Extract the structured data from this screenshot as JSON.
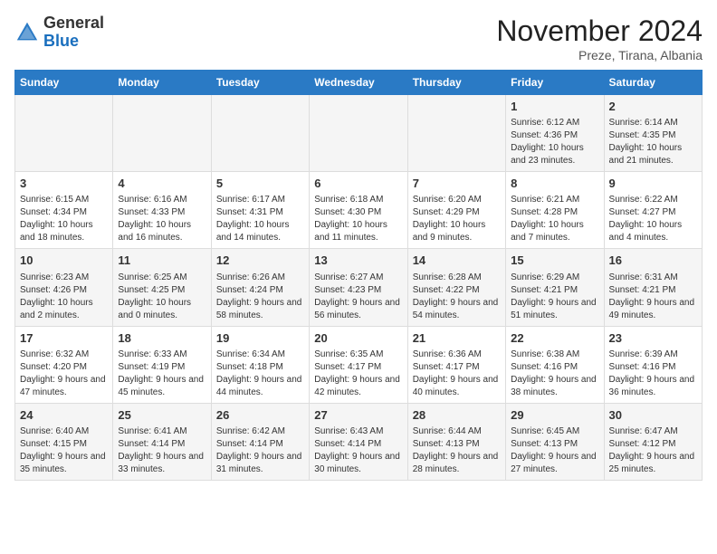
{
  "header": {
    "logo_general": "General",
    "logo_blue": "Blue",
    "month_title": "November 2024",
    "subtitle": "Preze, Tirana, Albania"
  },
  "weekdays": [
    "Sunday",
    "Monday",
    "Tuesday",
    "Wednesday",
    "Thursday",
    "Friday",
    "Saturday"
  ],
  "weeks": [
    [
      {
        "day": "",
        "info": ""
      },
      {
        "day": "",
        "info": ""
      },
      {
        "day": "",
        "info": ""
      },
      {
        "day": "",
        "info": ""
      },
      {
        "day": "",
        "info": ""
      },
      {
        "day": "1",
        "info": "Sunrise: 6:12 AM\nSunset: 4:36 PM\nDaylight: 10 hours and 23 minutes."
      },
      {
        "day": "2",
        "info": "Sunrise: 6:14 AM\nSunset: 4:35 PM\nDaylight: 10 hours and 21 minutes."
      }
    ],
    [
      {
        "day": "3",
        "info": "Sunrise: 6:15 AM\nSunset: 4:34 PM\nDaylight: 10 hours and 18 minutes."
      },
      {
        "day": "4",
        "info": "Sunrise: 6:16 AM\nSunset: 4:33 PM\nDaylight: 10 hours and 16 minutes."
      },
      {
        "day": "5",
        "info": "Sunrise: 6:17 AM\nSunset: 4:31 PM\nDaylight: 10 hours and 14 minutes."
      },
      {
        "day": "6",
        "info": "Sunrise: 6:18 AM\nSunset: 4:30 PM\nDaylight: 10 hours and 11 minutes."
      },
      {
        "day": "7",
        "info": "Sunrise: 6:20 AM\nSunset: 4:29 PM\nDaylight: 10 hours and 9 minutes."
      },
      {
        "day": "8",
        "info": "Sunrise: 6:21 AM\nSunset: 4:28 PM\nDaylight: 10 hours and 7 minutes."
      },
      {
        "day": "9",
        "info": "Sunrise: 6:22 AM\nSunset: 4:27 PM\nDaylight: 10 hours and 4 minutes."
      }
    ],
    [
      {
        "day": "10",
        "info": "Sunrise: 6:23 AM\nSunset: 4:26 PM\nDaylight: 10 hours and 2 minutes."
      },
      {
        "day": "11",
        "info": "Sunrise: 6:25 AM\nSunset: 4:25 PM\nDaylight: 10 hours and 0 minutes."
      },
      {
        "day": "12",
        "info": "Sunrise: 6:26 AM\nSunset: 4:24 PM\nDaylight: 9 hours and 58 minutes."
      },
      {
        "day": "13",
        "info": "Sunrise: 6:27 AM\nSunset: 4:23 PM\nDaylight: 9 hours and 56 minutes."
      },
      {
        "day": "14",
        "info": "Sunrise: 6:28 AM\nSunset: 4:22 PM\nDaylight: 9 hours and 54 minutes."
      },
      {
        "day": "15",
        "info": "Sunrise: 6:29 AM\nSunset: 4:21 PM\nDaylight: 9 hours and 51 minutes."
      },
      {
        "day": "16",
        "info": "Sunrise: 6:31 AM\nSunset: 4:21 PM\nDaylight: 9 hours and 49 minutes."
      }
    ],
    [
      {
        "day": "17",
        "info": "Sunrise: 6:32 AM\nSunset: 4:20 PM\nDaylight: 9 hours and 47 minutes."
      },
      {
        "day": "18",
        "info": "Sunrise: 6:33 AM\nSunset: 4:19 PM\nDaylight: 9 hours and 45 minutes."
      },
      {
        "day": "19",
        "info": "Sunrise: 6:34 AM\nSunset: 4:18 PM\nDaylight: 9 hours and 44 minutes."
      },
      {
        "day": "20",
        "info": "Sunrise: 6:35 AM\nSunset: 4:17 PM\nDaylight: 9 hours and 42 minutes."
      },
      {
        "day": "21",
        "info": "Sunrise: 6:36 AM\nSunset: 4:17 PM\nDaylight: 9 hours and 40 minutes."
      },
      {
        "day": "22",
        "info": "Sunrise: 6:38 AM\nSunset: 4:16 PM\nDaylight: 9 hours and 38 minutes."
      },
      {
        "day": "23",
        "info": "Sunrise: 6:39 AM\nSunset: 4:16 PM\nDaylight: 9 hours and 36 minutes."
      }
    ],
    [
      {
        "day": "24",
        "info": "Sunrise: 6:40 AM\nSunset: 4:15 PM\nDaylight: 9 hours and 35 minutes."
      },
      {
        "day": "25",
        "info": "Sunrise: 6:41 AM\nSunset: 4:14 PM\nDaylight: 9 hours and 33 minutes."
      },
      {
        "day": "26",
        "info": "Sunrise: 6:42 AM\nSunset: 4:14 PM\nDaylight: 9 hours and 31 minutes."
      },
      {
        "day": "27",
        "info": "Sunrise: 6:43 AM\nSunset: 4:14 PM\nDaylight: 9 hours and 30 minutes."
      },
      {
        "day": "28",
        "info": "Sunrise: 6:44 AM\nSunset: 4:13 PM\nDaylight: 9 hours and 28 minutes."
      },
      {
        "day": "29",
        "info": "Sunrise: 6:45 AM\nSunset: 4:13 PM\nDaylight: 9 hours and 27 minutes."
      },
      {
        "day": "30",
        "info": "Sunrise: 6:47 AM\nSunset: 4:12 PM\nDaylight: 9 hours and 25 minutes."
      }
    ]
  ]
}
